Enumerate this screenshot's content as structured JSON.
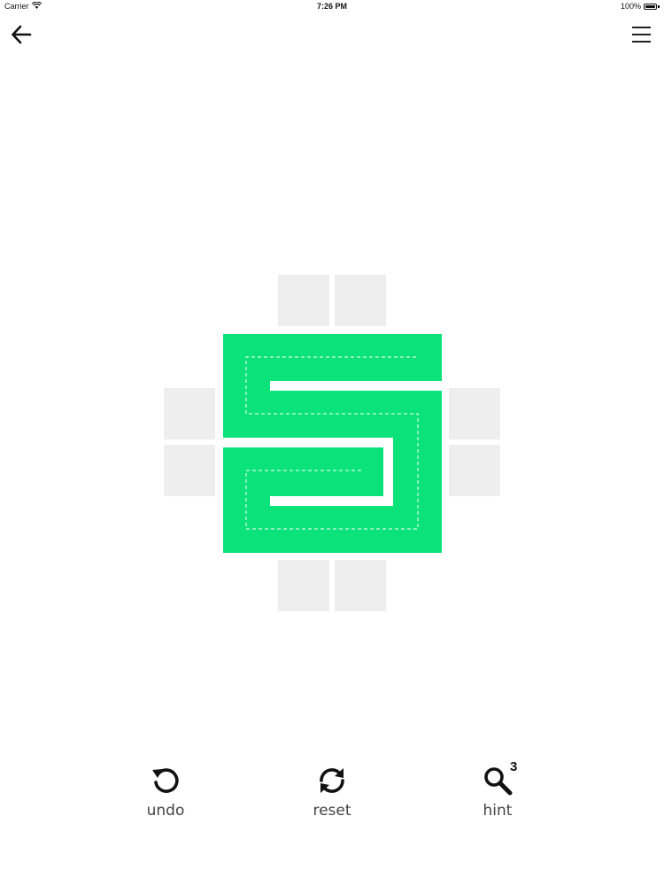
{
  "status_bar": {
    "carrier": "Carrier",
    "time": "7:26 PM",
    "battery": "100%",
    "battery_level": 1.0
  },
  "nav": {
    "back_icon": "arrow-left-icon",
    "menu_icon": "hamburger-menu-icon"
  },
  "puzzle": {
    "fill_color": "#0be37a",
    "empty_tile_color": "#eeeeee",
    "path_color": "#ffffff",
    "solved": true
  },
  "toolbar": {
    "undo_label": "undo",
    "reset_label": "reset",
    "hint_label": "hint",
    "hint_count": "3"
  }
}
